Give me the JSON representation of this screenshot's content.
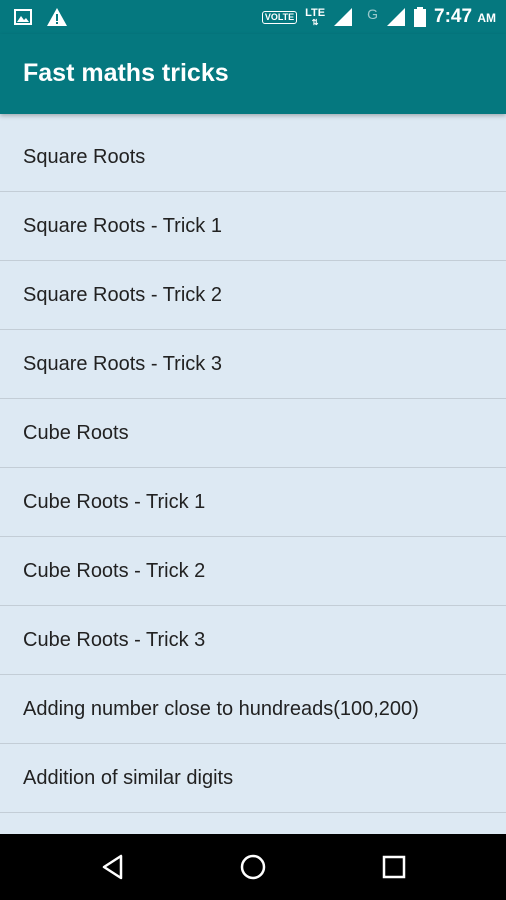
{
  "status_bar": {
    "volte": "VOLTE",
    "lte": "LTE",
    "g": "G",
    "time": "7:47",
    "ampm": "AM",
    "icons": [
      "image-icon",
      "warning-icon",
      "signal-icon",
      "signal-icon",
      "battery-icon"
    ]
  },
  "app_bar": {
    "title": "Fast maths tricks",
    "color": "#05787f"
  },
  "list": {
    "items": [
      "Square Roots",
      "Square Roots - Trick 1",
      "Square Roots - Trick 2",
      "Square Roots - Trick 3",
      "Cube Roots",
      "Cube Roots - Trick 1",
      "Cube Roots - Trick 2",
      "Cube Roots - Trick 3",
      "Adding number close to hundreads(100,200)",
      "Addition of similar digits"
    ]
  },
  "nav_bar": {
    "buttons": [
      "back-icon",
      "home-icon",
      "recents-icon"
    ]
  }
}
